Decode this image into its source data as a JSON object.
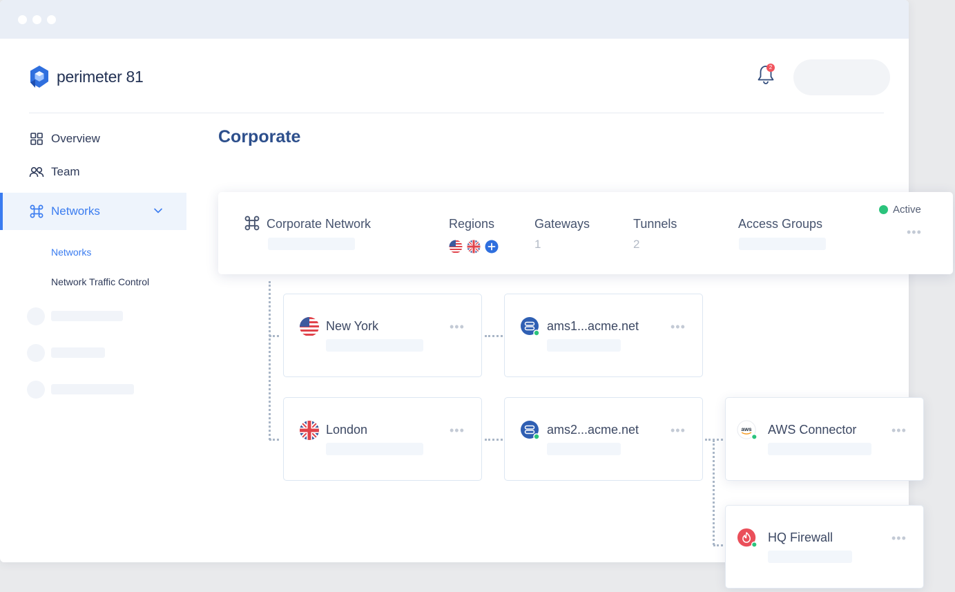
{
  "brand": {
    "name": "perimeter 81"
  },
  "header": {
    "notification_count": "2"
  },
  "sidebar": {
    "items": [
      {
        "label": "Overview"
      },
      {
        "label": "Team"
      },
      {
        "label": "Networks"
      }
    ],
    "subitems": [
      {
        "label": "Networks"
      },
      {
        "label": "Network Traffic Control"
      }
    ]
  },
  "main": {
    "title": "Corporate",
    "network": {
      "name": "Corporate Network",
      "status": "Active",
      "columns": {
        "regions": "Regions",
        "gateways": "Gateways",
        "tunnels": "Tunnels",
        "access_groups": "Access Groups"
      },
      "gateways_count": "1",
      "tunnels_count": "2"
    },
    "nodes": {
      "new_york": "New York",
      "london": "London",
      "ams1": "ams1...acme.net",
      "ams2": "ams2...acme.net",
      "aws": "AWS Connector",
      "aws_logo": "aws",
      "hq": "HQ Firewall"
    }
  },
  "colors": {
    "accent": "#3a7cf0",
    "title": "#2d4f8c",
    "active": "#2bc37c",
    "danger": "#f1545d"
  }
}
